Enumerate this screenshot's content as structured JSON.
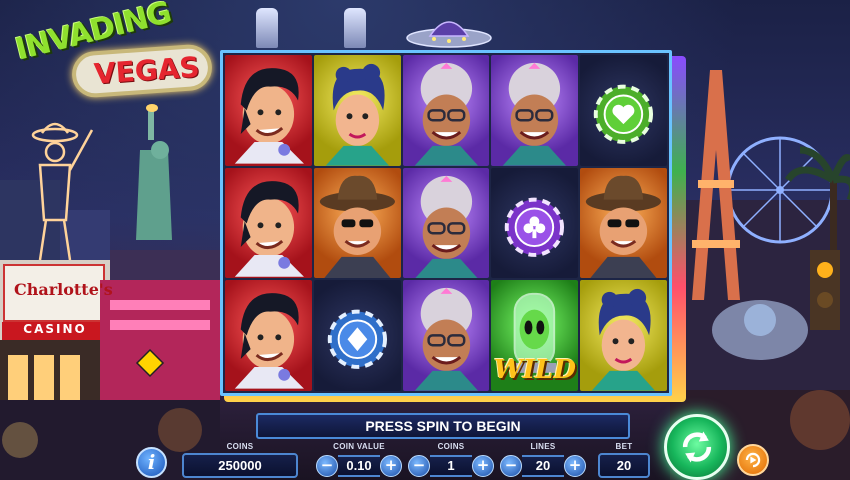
{
  "game": {
    "logo_line1": "INVADING",
    "logo_line2": "VEGAS"
  },
  "scenery": {
    "casino_name": "Charlotte's",
    "casino_sign": "CASINO"
  },
  "reels": {
    "rows": [
      [
        "elvis",
        "lady",
        "granny",
        "granny",
        "chip-heart"
      ],
      [
        "elvis",
        "cowboy",
        "granny",
        "chip-club",
        "cowboy"
      ],
      [
        "elvis",
        "chip-diamond",
        "granny",
        "alien-wild",
        "lady"
      ]
    ],
    "wild_label": "WILD"
  },
  "message": "PRESS SPIN TO BEGIN",
  "controls": {
    "coins_label": "COINS",
    "coins_value": "250000",
    "coin_value_label": "COIN VALUE",
    "coin_value": "0.10",
    "coins_bet_label": "COINS",
    "coins_bet": "1",
    "lines_label": "LINES",
    "lines": "20",
    "bet_label": "BET",
    "bet": "20",
    "minus": "−",
    "plus": "+",
    "info": "i"
  },
  "colors": {
    "accent": "#4d86d0",
    "spin": "#17b65b",
    "autoplay": "#e06a00"
  }
}
